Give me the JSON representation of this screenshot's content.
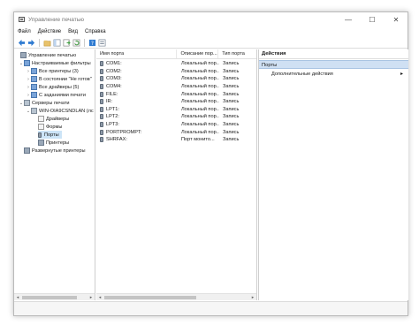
{
  "window": {
    "title": "Управление печатью",
    "minimize_glyph": "—",
    "maximize_glyph": "☐",
    "close_glyph": "✕"
  },
  "menu": [
    "Файл",
    "Действие",
    "Вид",
    "Справка"
  ],
  "toolbar": [
    "back-arrow-icon",
    "forward-arrow-icon",
    "up-folder-icon",
    "show-tree-icon",
    "export-list-icon",
    "refresh-icon",
    "help-icon",
    "properties-icon"
  ],
  "tree": {
    "root": "Управление печатью",
    "custom_filters": "Настраиваемые фильтры",
    "all_printers": "Все принтеры (3)",
    "not_ready": "В состоянии \"Не готов\"",
    "all_drivers": "Все драйверы (5)",
    "with_jobs": "С заданиями печати",
    "print_servers": "Серверы печати",
    "server_name": "WIN-OIA9CSNDLAN (лс",
    "drivers": "Драйверы",
    "forms": "Формы",
    "ports": "Порты",
    "printers": "Принтеры",
    "deployed_printers": "Развернутые принтеры"
  },
  "table": {
    "headers": [
      "Имя порта",
      "Описание пор...",
      "Тип порта"
    ],
    "rows": [
      {
        "name": "COM1:",
        "desc": "Локальный пор...",
        "type": "Запись"
      },
      {
        "name": "COM2:",
        "desc": "Локальный пор...",
        "type": "Запись"
      },
      {
        "name": "COM3:",
        "desc": "Локальный пор...",
        "type": "Запись"
      },
      {
        "name": "COM4:",
        "desc": "Локальный пор...",
        "type": "Запись"
      },
      {
        "name": "FILE:",
        "desc": "Локальный пор...",
        "type": "Запись"
      },
      {
        "name": "IR:",
        "desc": "Локальный пор...",
        "type": "Запись"
      },
      {
        "name": "LPT1:",
        "desc": "Локальный пор...",
        "type": "Запись"
      },
      {
        "name": "LPT2:",
        "desc": "Локальный пор...",
        "type": "Запись"
      },
      {
        "name": "LPT3:",
        "desc": "Локальный пор...",
        "type": "Запись"
      },
      {
        "name": "PORTPROMPT:",
        "desc": "Локальный пор...",
        "type": "Запись"
      },
      {
        "name": "SHRFAX:",
        "desc": "Порт монито...",
        "type": "Запись"
      }
    ]
  },
  "actions": {
    "header": "Действия",
    "section": "Порты",
    "more": "Дополнительные действия",
    "more_arrow": "▸"
  },
  "colors": {
    "selection": "#cce4f7",
    "section": "#cfe0f3"
  }
}
